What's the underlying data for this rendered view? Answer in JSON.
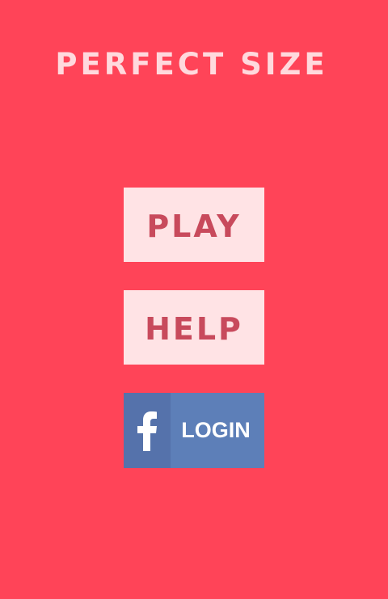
{
  "title": "PERFECT SIZE",
  "menu": {
    "play_label": "PLAY",
    "help_label": "HELP",
    "login_label": "LOGIN",
    "login_icon": "facebook-f-icon"
  },
  "colors": {
    "background": "#ff4458",
    "title_text": "#ffd9dd",
    "button_bg": "#ffe3e5",
    "button_text": "#c84a5c",
    "facebook_blue": "#5d7fb8",
    "facebook_icon_bg": "#5572ab"
  }
}
